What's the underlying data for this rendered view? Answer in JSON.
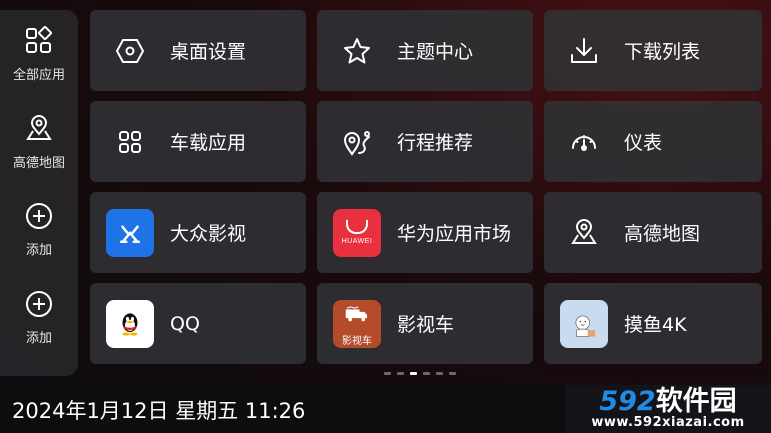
{
  "dock": {
    "items": [
      {
        "label": "全部应用",
        "icon": "all-apps-icon"
      },
      {
        "label": "高德地图",
        "icon": "map-pin-icon"
      },
      {
        "label": "添加",
        "icon": "add-circle-icon"
      },
      {
        "label": "添加",
        "icon": "add-circle-icon"
      }
    ]
  },
  "tiles": [
    {
      "label": "桌面设置",
      "icon": "hexagon-settings-icon"
    },
    {
      "label": "主题中心",
      "icon": "star-icon"
    },
    {
      "label": "下载列表",
      "icon": "download-icon"
    },
    {
      "label": "车载应用",
      "icon": "app-grid-icon"
    },
    {
      "label": "行程推荐",
      "icon": "route-icon"
    },
    {
      "label": "仪表",
      "icon": "gauge-icon"
    },
    {
      "label": "大众影视",
      "icon": "dazhong-app-icon"
    },
    {
      "label": "华为应用市场",
      "icon": "huawei-appgallery-icon",
      "brand_text": "HUAWEI"
    },
    {
      "label": "高德地图",
      "icon": "map-pin-icon"
    },
    {
      "label": "QQ",
      "icon": "qq-penguin-icon"
    },
    {
      "label": "影视车",
      "icon": "yingshiche-app-icon",
      "brand_text": "影视车"
    },
    {
      "label": "摸鱼4K",
      "icon": "moyu-app-icon"
    }
  ],
  "pager": {
    "count": 6,
    "active": 2
  },
  "status": {
    "datetime": "2024年1月12日 星期五 11:26"
  },
  "watermark": {
    "brand_num": "592",
    "brand_cn": "软件园",
    "url": "www.592xiazai.com"
  },
  "colors": {
    "accent_red": "#4a1014",
    "watermark_blue": "#1e8ce6"
  }
}
